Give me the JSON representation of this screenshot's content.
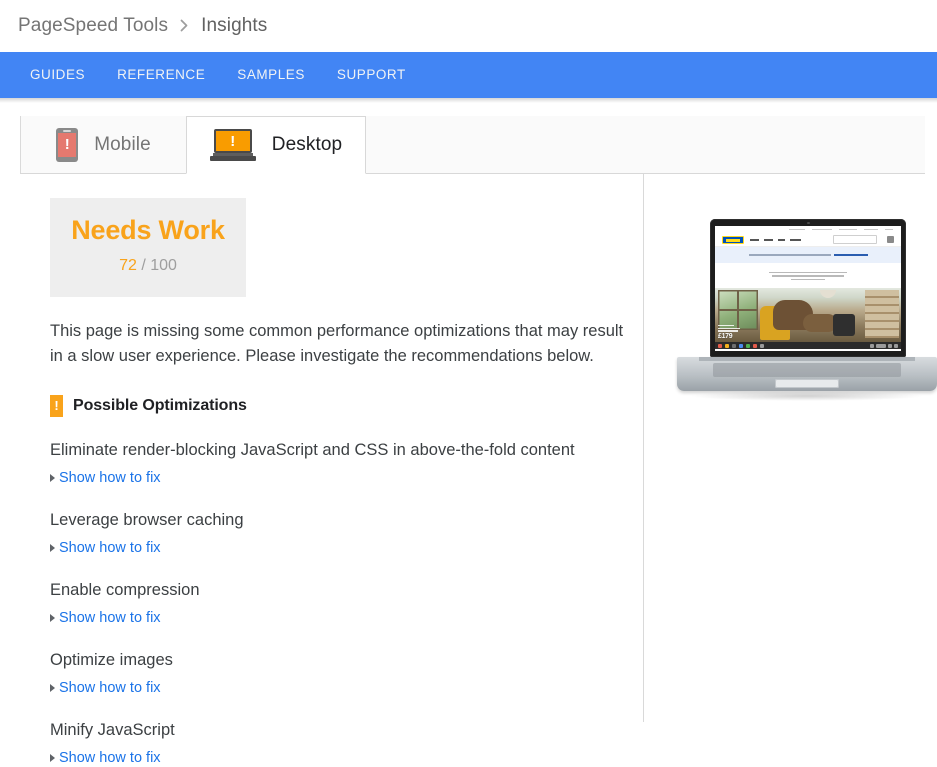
{
  "breadcrumb": {
    "root": "PageSpeed Tools",
    "separator_icon": "chevron-right-icon",
    "current": "Insights"
  },
  "nav": {
    "items": [
      {
        "label": "GUIDES"
      },
      {
        "label": "REFERENCE"
      },
      {
        "label": "SAMPLES"
      },
      {
        "label": "SUPPORT"
      }
    ],
    "background_color": "#4285F4",
    "text_color": "#F1F3F4"
  },
  "tabs": [
    {
      "label": "Mobile",
      "icon": "mobile-phone-warning-icon",
      "active": false,
      "icon_color": "#E5796F"
    },
    {
      "label": "Desktop",
      "icon": "laptop-warning-icon",
      "active": true,
      "icon_color": "#F99C00"
    }
  ],
  "score": {
    "rating": "Needs Work",
    "value": "72",
    "divider": "/",
    "max": "100",
    "accent_color": "#F9A31B",
    "card_background": "#EEEEEE"
  },
  "summary": "This page is missing some common performance optimizations that may result in a slow user experience. Please investigate the recommendations below.",
  "section": {
    "badge_icon": "warning-exclamation-badge",
    "badge_glyph": "!",
    "title": "Possible Optimizations"
  },
  "link_label": "Show how to fix",
  "link_color": "#1A73E8",
  "rules": [
    {
      "title": "Eliminate render-blocking JavaScript and CSS in above-the-fold content",
      "link": "Show how to fix"
    },
    {
      "title": "Leverage browser caching",
      "link": "Show how to fix"
    },
    {
      "title": "Enable compression",
      "link": "Show how to fix"
    },
    {
      "title": "Optimize images",
      "link": "Show how to fix"
    },
    {
      "title": "Minify JavaScript",
      "link": "Show how to fix"
    }
  ],
  "preview": {
    "device": "laptop-screenshot-preview",
    "site_brand": "IKEA",
    "hero_heading": "Relax into greatness",
    "price": "£179"
  }
}
